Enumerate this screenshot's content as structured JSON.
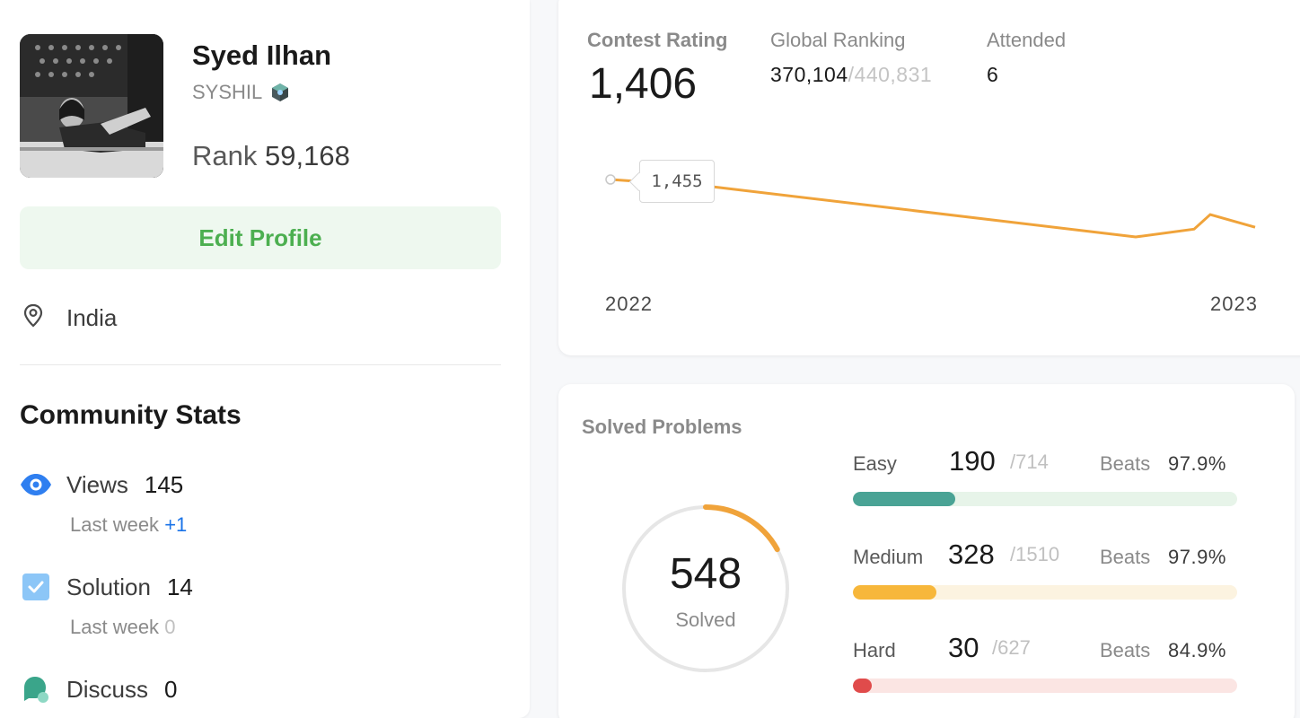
{
  "profile": {
    "name": "Syed Ilhan",
    "username": "SYSHIL",
    "rank_label": "Rank",
    "rank_value": "59,168",
    "edit_button": "Edit Profile",
    "location": "India"
  },
  "community": {
    "title": "Community Stats",
    "stats": [
      {
        "label": "Views",
        "value": "145",
        "sub_label": "Last week",
        "delta": "+1"
      },
      {
        "label": "Solution",
        "value": "14",
        "sub_label": "Last week",
        "delta": "0"
      },
      {
        "label": "Discuss",
        "value": "0"
      }
    ]
  },
  "contest": {
    "rating_label": "Contest Rating",
    "rating_value": "1,406",
    "global_label": "Global Ranking",
    "global_rank": "370,104",
    "global_total": "/440,831",
    "attended_label": "Attended",
    "attended_value": "6",
    "tooltip": "1,455",
    "x_start": "2022",
    "x_end": "2023",
    "line_color": "#f0a33a"
  },
  "chart_data": {
    "type": "line",
    "x": [
      "2022",
      "",
      "",
      "",
      "",
      "2023"
    ],
    "series": [
      {
        "values": [
          1455,
          1448,
          1396,
          1404,
          1419,
          1406
        ]
      }
    ]
  },
  "solved": {
    "title": "Solved Problems",
    "total": "548",
    "total_label": "Solved",
    "ring_fraction": 0.17,
    "ring_color": "#f0a33a",
    "difficulties": [
      {
        "label": "Easy",
        "count": "190",
        "total": "/714",
        "beats_label": "Beats",
        "beats": "97.9%",
        "fraction": 0.266,
        "color": "#4aa395",
        "track": "#e7f4e9"
      },
      {
        "label": "Medium",
        "count": "328",
        "total": "/1510",
        "beats_label": "Beats",
        "beats": "97.9%",
        "fraction": 0.217,
        "color": "#f7b73b",
        "track": "#fcf3e0"
      },
      {
        "label": "Hard",
        "count": "30",
        "total": "/627",
        "beats_label": "Beats",
        "beats": "84.9%",
        "fraction": 0.048,
        "color": "#e04b4b",
        "track": "#fbe5e3"
      }
    ]
  }
}
